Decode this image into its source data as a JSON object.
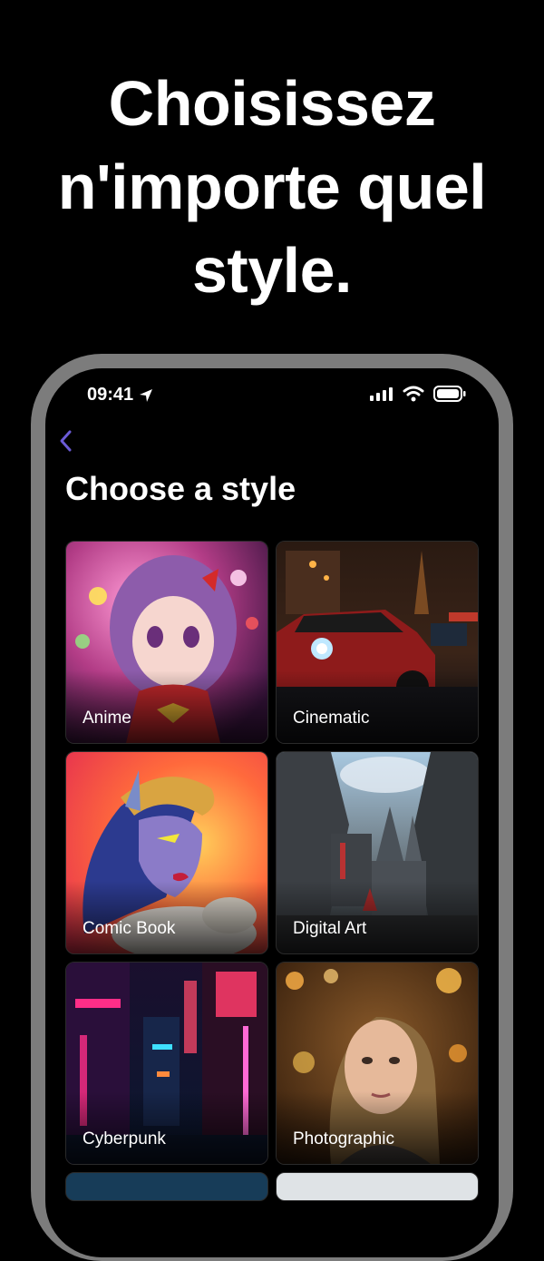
{
  "headline": {
    "line1": "Choisissez",
    "line2": "n'importe quel",
    "line3": "style."
  },
  "status": {
    "time": "09:41",
    "icons": [
      "location-arrow-icon",
      "signal-bars-icon",
      "wifi-icon",
      "battery-icon"
    ]
  },
  "nav": {
    "back_icon": "chevron-left-icon",
    "accent": "#6b5bd6"
  },
  "page": {
    "title": "Choose a style"
  },
  "styles": [
    {
      "label": "Anime"
    },
    {
      "label": "Cinematic"
    },
    {
      "label": "Comic Book"
    },
    {
      "label": "Digital Art"
    },
    {
      "label": "Cyberpunk"
    },
    {
      "label": "Photographic"
    }
  ]
}
